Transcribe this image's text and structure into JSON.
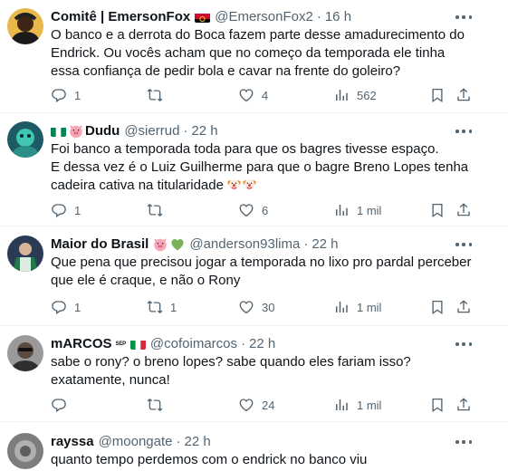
{
  "tweets": [
    {
      "name": "Comitê | EmersonFox",
      "handle": "@EmersonFox2",
      "time": "16 h",
      "text": "O banco e a derrota do Boca fazem parte desse amadurecimento do Endrick. Ou vocês acham que no começo da temporada ele tinha essa confiança de pedir bola e cavar na frente do goleiro?",
      "replies": "1",
      "retweets": "",
      "likes": "4",
      "views": "562",
      "flag_icon": "angola-flag-icon"
    },
    {
      "name": "Dudu",
      "handle": "@sierrud",
      "time": "22 h",
      "text_line1": "Foi banco a temporada toda para que os bagres tivesse espaço.",
      "text_line2": "E dessa vez é o Luiz Guilherme para que o bagre Breno Lopes tenha cadeira cativa na titularidade",
      "replies": "1",
      "retweets": "",
      "likes": "6",
      "views": "1 mil",
      "emoji_icons": [
        "nigeria-flag-icon",
        "pig-face-icon",
        "clown-face-icon",
        "clown-face-icon"
      ]
    },
    {
      "name": "Maior do Brasil",
      "handle": "@anderson93lima",
      "time": "22 h",
      "text": "Que pena que precisou jogar a temporada no lixo pro pardal perceber que ele é craque, e não o Rony",
      "replies": "1",
      "retweets": "1",
      "likes": "30",
      "views": "1 mil",
      "emoji_icons": [
        "pig-face-icon",
        "green-heart-icon"
      ]
    },
    {
      "name": "mARCOS",
      "badge": "SEP",
      "handle": "@cofoimarcos",
      "time": "22 h",
      "text": "sabe o rony? o breno lopes? sabe quando eles fariam isso? exatamente, nunca!",
      "replies": "",
      "retweets": "",
      "likes": "24",
      "views": "1 mil",
      "emoji_icons": [
        "italy-flag-icon"
      ]
    },
    {
      "name": "rayssa",
      "handle": "@moongate",
      "time": "22 h",
      "text": "quanto tempo perdemos com o endrick no banco viu"
    }
  ],
  "colors": {
    "text": "#0f1419",
    "secondary": "#536471",
    "divider": "#eff3f4"
  }
}
